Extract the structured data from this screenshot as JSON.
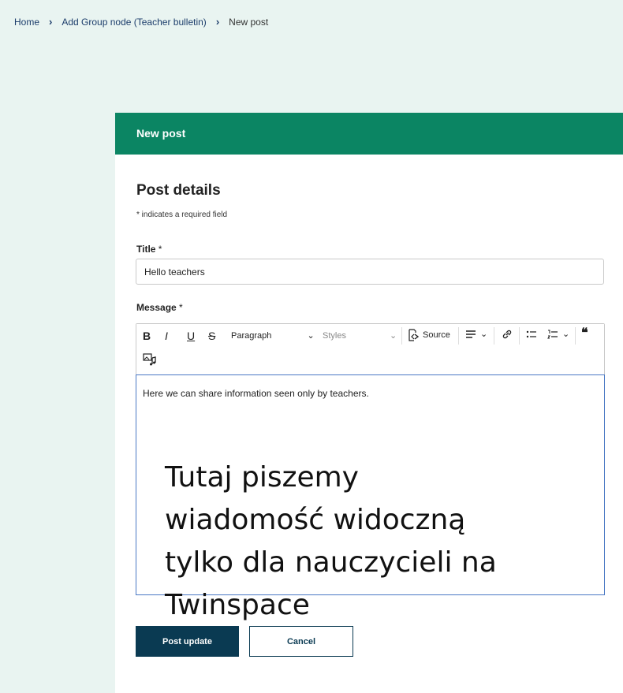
{
  "breadcrumb": {
    "home": "Home",
    "group": "Add Group node (Teacher bulletin)",
    "current": "New post",
    "separator": "›"
  },
  "card": {
    "header_title": "New post",
    "section_title": "Post details",
    "required_note": "* indicates a required field"
  },
  "form": {
    "title_label": "Title",
    "title_value": "Hello teachers",
    "message_label": "Message",
    "required_mark": "*"
  },
  "toolbar": {
    "bold": "B",
    "italic": "I",
    "underline": "U",
    "strike": "S",
    "paragraph": "Paragraph",
    "styles": "Styles",
    "source": "Source",
    "dropdown_caret": "⌄"
  },
  "editor": {
    "content": "Here we can share information seen only by teachers."
  },
  "overlay": {
    "lines": [
      "Tutaj piszemy",
      "wiadomość widoczną",
      "tylko dla nauczycieli na",
      "Twinspace"
    ]
  },
  "actions": {
    "submit": "Post update",
    "cancel": "Cancel"
  },
  "colors": {
    "page_bg": "#e9f4f1",
    "header_green": "#0b8563",
    "primary_button": "#0a3a52",
    "editor_focus_border": "#4a78c4"
  },
  "icons": [
    "source-icon",
    "align-icon",
    "link-icon",
    "bullet-list-icon",
    "numbered-list-icon",
    "blockquote-icon",
    "media-icon"
  ]
}
